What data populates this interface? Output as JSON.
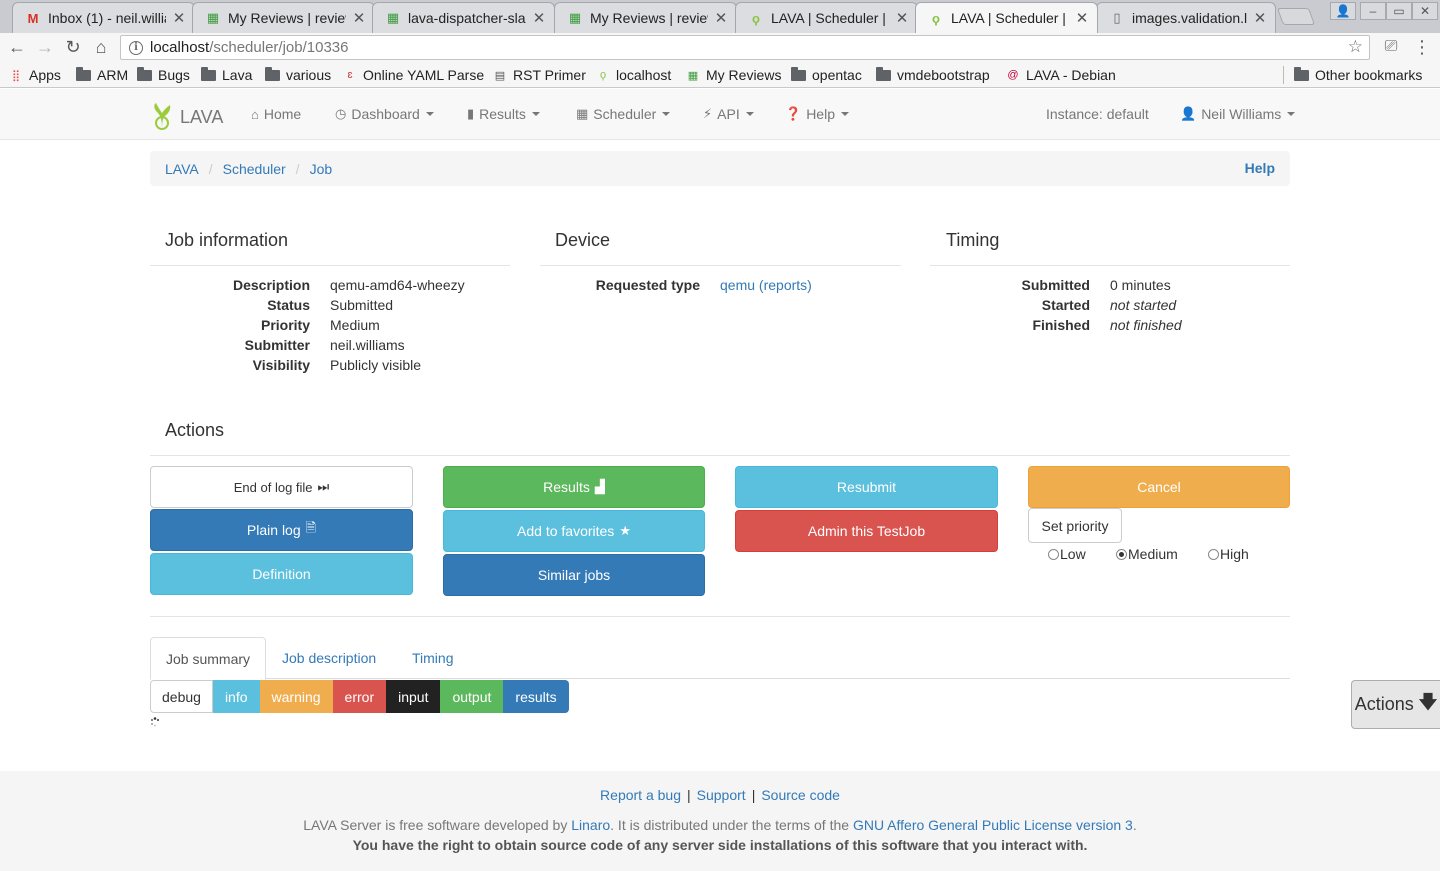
{
  "browser": {
    "tabs": [
      {
        "title": "Inbox (1) - neil.willia",
        "icon": "gmail-icon"
      },
      {
        "title": "My Reviews | review",
        "icon": "gerrit-icon"
      },
      {
        "title": "lava-dispatcher-sla",
        "icon": "gerrit-icon"
      },
      {
        "title": "My Reviews | review",
        "icon": "gerrit-icon"
      },
      {
        "title": "LAVA | Scheduler |",
        "icon": "lava-icon"
      },
      {
        "title": "LAVA | Scheduler |",
        "icon": "lava-icon"
      },
      {
        "title": "images.validation.l",
        "icon": "document-icon"
      }
    ],
    "url_host": "localhost",
    "url_path": "/scheduler/job/10336",
    "bookmarks": [
      {
        "label": "Apps"
      },
      {
        "label": "ARM"
      },
      {
        "label": "Bugs"
      },
      {
        "label": "Lava"
      },
      {
        "label": "various"
      },
      {
        "label": "Online YAML Parse"
      },
      {
        "label": "RST Primer"
      },
      {
        "label": "localhost"
      },
      {
        "label": "My Reviews"
      },
      {
        "label": "opentac"
      },
      {
        "label": "vmdebootstrap"
      },
      {
        "label": "LAVA - Debian"
      },
      {
        "label": "Other bookmarks"
      }
    ]
  },
  "navbar": {
    "brand": "LAVA",
    "home": "Home",
    "dashboard": "Dashboard",
    "results": "Results",
    "scheduler": "Scheduler",
    "api": "API",
    "help": "Help",
    "instance": "Instance: default",
    "user": "Neil Williams"
  },
  "breadcrumb": {
    "items": [
      "LAVA",
      "Scheduler",
      "Job"
    ],
    "help": "Help"
  },
  "job_info": {
    "title": "Job information",
    "rows": [
      {
        "label": "Description",
        "value": "qemu-amd64-wheezy"
      },
      {
        "label": "Status",
        "value": "Submitted"
      },
      {
        "label": "Priority",
        "value": "Medium"
      },
      {
        "label": "Submitter",
        "value": "neil.williams"
      },
      {
        "label": "Visibility",
        "value": "Publicly visible"
      }
    ]
  },
  "device": {
    "title": "Device",
    "requested_type_label": "Requested type",
    "requested_type_value": "qemu",
    "reports_link": "(reports)"
  },
  "timing": {
    "title": "Timing",
    "rows": [
      {
        "label": "Submitted",
        "value": "0 minutes"
      },
      {
        "label": "Started",
        "value": "not started"
      },
      {
        "label": "Finished",
        "value": "not finished"
      }
    ]
  },
  "actions": {
    "title": "Actions",
    "end_of_log": "End of log file",
    "plain_log": "Plain log",
    "definition": "Definition",
    "results": "Results",
    "add_favorites": "Add to favorites",
    "similar_jobs": "Similar jobs",
    "resubmit": "Resubmit",
    "admin": "Admin this TestJob",
    "cancel": "Cancel",
    "set_priority": "Set priority",
    "priority_options": [
      "Low",
      "Medium",
      "High"
    ],
    "priority_selected": "Medium"
  },
  "page_tabs": [
    "Job summary",
    "Job description",
    "Timing"
  ],
  "log_filters": [
    "debug",
    "info",
    "warning",
    "error",
    "input",
    "output",
    "results"
  ],
  "floating_actions": "Actions",
  "footer": {
    "report_bug": "Report a bug",
    "support": "Support",
    "source_code": "Source code",
    "line1_a": "LAVA Server is free software developed by ",
    "line1_linaro": "Linaro",
    "line1_b": ". It is distributed under the terms of the ",
    "line1_license": "GNU Affero General Public License version 3",
    "line1_c": ".",
    "line2": "You have the right to obtain source code of any server side installations of this software that you interact with."
  },
  "colors": {
    "link": "#337ab7",
    "primary": "#337ab7",
    "success": "#5cb85c",
    "info": "#5bc0de",
    "danger": "#d9534f",
    "warning": "#f0ad4e"
  }
}
